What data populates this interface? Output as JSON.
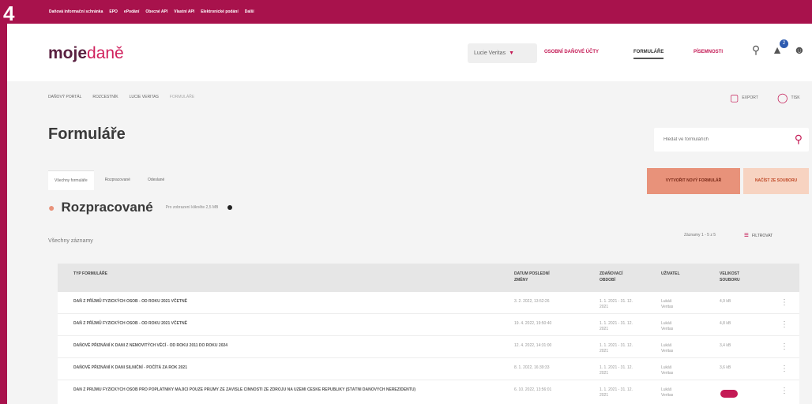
{
  "badge": "4",
  "top_links": [
    "Daňová informační schránka",
    "EPO",
    "ePodání",
    "Obecné API",
    "Vlastní API",
    "Elektronické podání",
    "Další"
  ],
  "header": {
    "logo_main": "moje",
    "logo_accent": "daně",
    "lang_selector": "Lucie Veritas",
    "nav": [
      "OSOBNÍ DAŇOVÉ ÚČTY",
      "FORMULÁŘE",
      "PÍSEMNOSTI"
    ],
    "notification_count": "2"
  },
  "breadcrumb": [
    "DAŇOVÝ PORTÁL",
    "ROZCESTNÍK",
    "LUCIE VERITAS",
    "FORMULÁŘE"
  ],
  "export_label": "EXPORT",
  "print_label": "TISK",
  "page_title": "Formuláře",
  "search_placeholder": "Hledat ve formulářích",
  "tabs": [
    "Všechny formuláře",
    "Rozpracované",
    "Odeslané"
  ],
  "buttons": {
    "new_form": "VYTVOŘIT NOVÝ FORMULÁŘ",
    "load_file": "NAČÍST ZE SOUBORU"
  },
  "section": {
    "title": "Rozpracované",
    "note": "Pro zobrazení klikněte 2,5 MB"
  },
  "all_records": "Všechny záznamy",
  "pagination": "Záznamy 1 - 5 z 5",
  "filter_label": "FILTROVAT",
  "table": {
    "headers": [
      "TYP FORMULÁŘE",
      "DATUM POSLEDNÍ ZMĚNY",
      "ZDAŇOVACÍ OBDOBÍ",
      "UŽIVATEL",
      "VELIKOST SOUBORU"
    ],
    "rows": [
      {
        "type": "DAŇ Z PŘÍJMŮ FYZICKÝCH OSOB - OD ROKU 2021 VČETNĚ",
        "date": "3. 2. 2022, 13:52:26",
        "period": "1. 1. 2021 - 31. 12. 2021",
        "user": "Lukáš Veritas",
        "size": "4,9 kB"
      },
      {
        "type": "DAŇ Z PŘÍJMŮ FYZICKÝCH OSOB - OD ROKU 2021 VČETNĚ",
        "date": "19. 4. 2022, 19:50:40",
        "period": "1. 1. 2021 - 31. 12. 2021",
        "user": "Lukáš Veritas",
        "size": "4,8 kB"
      },
      {
        "type": "DAŇOVÉ PŘIZNÁNÍ K DANI Z NEMOVITÝCH VĚCÍ - OD ROKU 2011 DO ROKU 2024",
        "date": "12. 4. 2022, 14:31:00",
        "period": "1. 1. 2021 - 31. 12. 2021",
        "user": "Lukáš Veritas",
        "size": "3,4 kB"
      },
      {
        "type": "DAŇOVÉ PŘIZNÁNÍ K DANI SILNIČNÍ - POČÍTÁ ZA ROK 2021",
        "date": "8. 1. 2022, 16:39:33",
        "period": "1. 1. 2021 - 31. 12. 2021",
        "user": "Lukáš Veritas",
        "size": "3,6 kB"
      },
      {
        "type": "DAŇ Z PŘÍJMŮ FYZICKÝCH OSOB PRO POPLATNÍKY MAJÍCÍ POUZE PŘÍJMY ZE ZÁVISLÉ ČINNOSTI ZE ZDROJŮ NA ÚZEMÍ ČESKÉ REPUBLIKY (STÁTNÍ DAŇOVÝCH NEREZIDENTŮ)",
        "date": "6. 10. 2022, 13:56:01",
        "period": "1. 1. 2021 - 31. 12. 2021",
        "user": "Lukáš Veritas",
        "size": ""
      }
    ]
  },
  "colors": {
    "brand": "#a8124c",
    "accent": "#c41a55",
    "button_primary": "#e8927a",
    "button_secondary": "#f7d3c1"
  }
}
